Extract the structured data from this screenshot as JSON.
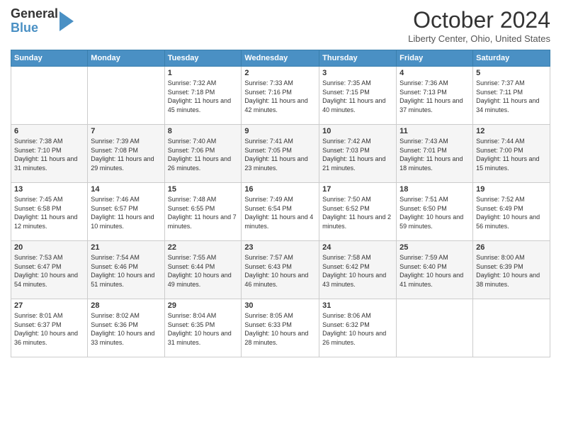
{
  "logo": {
    "general": "General",
    "blue": "Blue"
  },
  "header": {
    "month": "October 2024",
    "location": "Liberty Center, Ohio, United States"
  },
  "weekdays": [
    "Sunday",
    "Monday",
    "Tuesday",
    "Wednesday",
    "Thursday",
    "Friday",
    "Saturday"
  ],
  "weeks": [
    [
      {
        "day": "",
        "info": ""
      },
      {
        "day": "",
        "info": ""
      },
      {
        "day": "1",
        "info": "Sunrise: 7:32 AM\nSunset: 7:18 PM\nDaylight: 11 hours and 45 minutes."
      },
      {
        "day": "2",
        "info": "Sunrise: 7:33 AM\nSunset: 7:16 PM\nDaylight: 11 hours and 42 minutes."
      },
      {
        "day": "3",
        "info": "Sunrise: 7:35 AM\nSunset: 7:15 PM\nDaylight: 11 hours and 40 minutes."
      },
      {
        "day": "4",
        "info": "Sunrise: 7:36 AM\nSunset: 7:13 PM\nDaylight: 11 hours and 37 minutes."
      },
      {
        "day": "5",
        "info": "Sunrise: 7:37 AM\nSunset: 7:11 PM\nDaylight: 11 hours and 34 minutes."
      }
    ],
    [
      {
        "day": "6",
        "info": "Sunrise: 7:38 AM\nSunset: 7:10 PM\nDaylight: 11 hours and 31 minutes."
      },
      {
        "day": "7",
        "info": "Sunrise: 7:39 AM\nSunset: 7:08 PM\nDaylight: 11 hours and 29 minutes."
      },
      {
        "day": "8",
        "info": "Sunrise: 7:40 AM\nSunset: 7:06 PM\nDaylight: 11 hours and 26 minutes."
      },
      {
        "day": "9",
        "info": "Sunrise: 7:41 AM\nSunset: 7:05 PM\nDaylight: 11 hours and 23 minutes."
      },
      {
        "day": "10",
        "info": "Sunrise: 7:42 AM\nSunset: 7:03 PM\nDaylight: 11 hours and 21 minutes."
      },
      {
        "day": "11",
        "info": "Sunrise: 7:43 AM\nSunset: 7:01 PM\nDaylight: 11 hours and 18 minutes."
      },
      {
        "day": "12",
        "info": "Sunrise: 7:44 AM\nSunset: 7:00 PM\nDaylight: 11 hours and 15 minutes."
      }
    ],
    [
      {
        "day": "13",
        "info": "Sunrise: 7:45 AM\nSunset: 6:58 PM\nDaylight: 11 hours and 12 minutes."
      },
      {
        "day": "14",
        "info": "Sunrise: 7:46 AM\nSunset: 6:57 PM\nDaylight: 11 hours and 10 minutes."
      },
      {
        "day": "15",
        "info": "Sunrise: 7:48 AM\nSunset: 6:55 PM\nDaylight: 11 hours and 7 minutes."
      },
      {
        "day": "16",
        "info": "Sunrise: 7:49 AM\nSunset: 6:54 PM\nDaylight: 11 hours and 4 minutes."
      },
      {
        "day": "17",
        "info": "Sunrise: 7:50 AM\nSunset: 6:52 PM\nDaylight: 11 hours and 2 minutes."
      },
      {
        "day": "18",
        "info": "Sunrise: 7:51 AM\nSunset: 6:50 PM\nDaylight: 10 hours and 59 minutes."
      },
      {
        "day": "19",
        "info": "Sunrise: 7:52 AM\nSunset: 6:49 PM\nDaylight: 10 hours and 56 minutes."
      }
    ],
    [
      {
        "day": "20",
        "info": "Sunrise: 7:53 AM\nSunset: 6:47 PM\nDaylight: 10 hours and 54 minutes."
      },
      {
        "day": "21",
        "info": "Sunrise: 7:54 AM\nSunset: 6:46 PM\nDaylight: 10 hours and 51 minutes."
      },
      {
        "day": "22",
        "info": "Sunrise: 7:55 AM\nSunset: 6:44 PM\nDaylight: 10 hours and 49 minutes."
      },
      {
        "day": "23",
        "info": "Sunrise: 7:57 AM\nSunset: 6:43 PM\nDaylight: 10 hours and 46 minutes."
      },
      {
        "day": "24",
        "info": "Sunrise: 7:58 AM\nSunset: 6:42 PM\nDaylight: 10 hours and 43 minutes."
      },
      {
        "day": "25",
        "info": "Sunrise: 7:59 AM\nSunset: 6:40 PM\nDaylight: 10 hours and 41 minutes."
      },
      {
        "day": "26",
        "info": "Sunrise: 8:00 AM\nSunset: 6:39 PM\nDaylight: 10 hours and 38 minutes."
      }
    ],
    [
      {
        "day": "27",
        "info": "Sunrise: 8:01 AM\nSunset: 6:37 PM\nDaylight: 10 hours and 36 minutes."
      },
      {
        "day": "28",
        "info": "Sunrise: 8:02 AM\nSunset: 6:36 PM\nDaylight: 10 hours and 33 minutes."
      },
      {
        "day": "29",
        "info": "Sunrise: 8:04 AM\nSunset: 6:35 PM\nDaylight: 10 hours and 31 minutes."
      },
      {
        "day": "30",
        "info": "Sunrise: 8:05 AM\nSunset: 6:33 PM\nDaylight: 10 hours and 28 minutes."
      },
      {
        "day": "31",
        "info": "Sunrise: 8:06 AM\nSunset: 6:32 PM\nDaylight: 10 hours and 26 minutes."
      },
      {
        "day": "",
        "info": ""
      },
      {
        "day": "",
        "info": ""
      }
    ]
  ]
}
